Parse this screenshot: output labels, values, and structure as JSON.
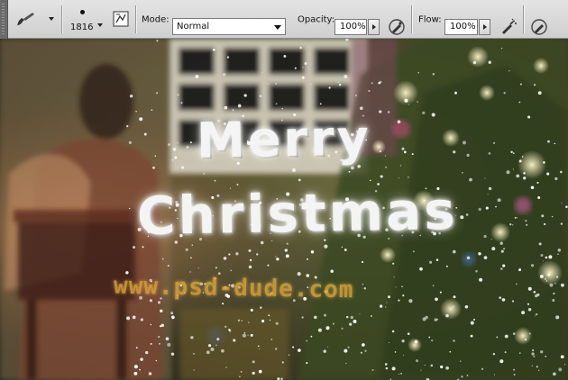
{
  "options_bar": {
    "brush_size": "1816",
    "mode_label": "Mode:",
    "mode_value": "Normal",
    "opacity_label": "Opacity:",
    "opacity_value": "100%",
    "flow_label": "Flow:",
    "flow_value": "100%"
  },
  "canvas": {
    "line1": "Merry",
    "line2": "Christmas",
    "watermark": "www.psd-dude.com"
  },
  "icons": [
    "brush-tool-icon",
    "caret-down-icon",
    "toggle-brush-panel-icon",
    "pressure-opacity-icon",
    "airbrush-icon",
    "pressure-size-icon"
  ],
  "colors": {
    "toolbar_bg": "#d9d9d9",
    "text_glow": "#ffffff",
    "watermark": "#d8a23a"
  }
}
